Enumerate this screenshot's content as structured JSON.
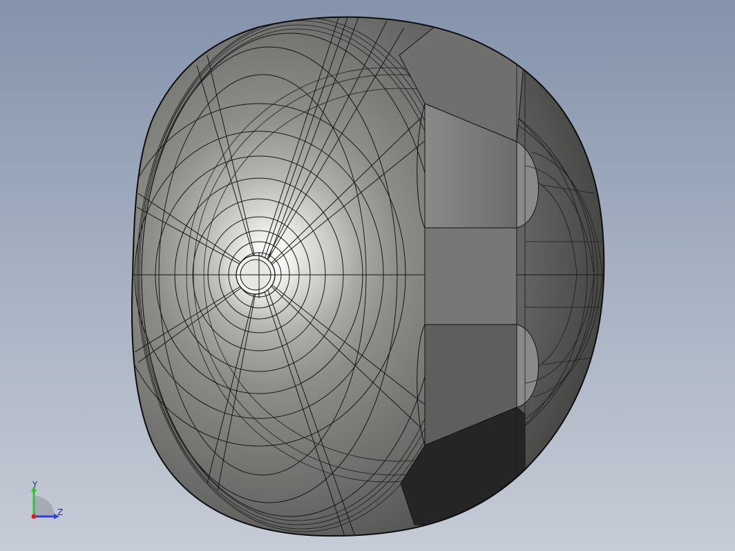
{
  "viewport": {
    "background_top": "#8493ab",
    "background_bottom": "#c6ccd6"
  },
  "model": {
    "description_icon": "reflector-lamp-housing-wireframe",
    "shell_color": "#6f6f6d",
    "highlight_color": "#f6f6ee",
    "edge_color": "#111111",
    "flat_face_color": "#7e7e7c",
    "dark_face_color": "#252525"
  },
  "triad": {
    "y_label": "Y",
    "z_label": "Z",
    "y_color": "#2fc42f",
    "z_color": "#2f3fd8",
    "x_color": "#d81f1f"
  }
}
